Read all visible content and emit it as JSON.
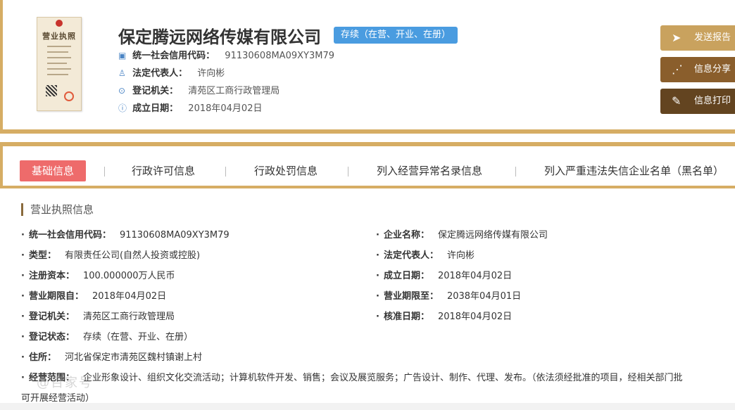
{
  "company": {
    "name": "保定腾远网络传媒有限公司",
    "status": "存续（在营、开业、在册）"
  },
  "license_image": {
    "title": "营业执照"
  },
  "summary": [
    {
      "icon": "id-card-icon",
      "label": "统一社会信用代码：",
      "value": "91130608MA09XY3M79"
    },
    {
      "icon": "person-icon",
      "label": "法定代表人：",
      "value": "许向彬"
    },
    {
      "icon": "location-pin-icon",
      "label": "登记机关：",
      "value": "清苑区工商行政管理局"
    },
    {
      "icon": "info-icon",
      "label": "成立日期：",
      "value": "2018年04月02日"
    }
  ],
  "actions": [
    {
      "label": "发送报告",
      "icon": "paper-plane-icon",
      "color": "#c9a25e"
    },
    {
      "label": "信息分享",
      "icon": "share-icon",
      "color": "#8a5e2c"
    },
    {
      "label": "信息打印",
      "icon": "pencil-icon",
      "color": "#634420"
    }
  ],
  "tabs": [
    {
      "label": "基础信息",
      "active": true
    },
    {
      "label": "行政许可信息"
    },
    {
      "label": "行政处罚信息"
    },
    {
      "label": "列入经营异常名录信息"
    },
    {
      "label": "列入严重违法失信企业名单（黑名单）"
    }
  ],
  "section": {
    "title": "营业执照信息"
  },
  "details_left": [
    {
      "label": "统一社会信用代码：",
      "value": "91130608MA09XY3M79"
    },
    {
      "label": "类型：",
      "value": "有限责任公司(自然人投资或控股)"
    },
    {
      "label": "注册资本：",
      "value": "100.000000万人民币"
    },
    {
      "label": "营业期限自：",
      "value": "2018年04月02日"
    },
    {
      "label": "登记机关：",
      "value": "清苑区工商行政管理局"
    },
    {
      "label": "登记状态：",
      "value": "存续（在营、开业、在册）"
    },
    {
      "label": "住所：",
      "value": "河北省保定市清苑区魏村镇谢上村"
    }
  ],
  "details_right": [
    {
      "label": "企业名称：",
      "value": "保定腾远网络传媒有限公司"
    },
    {
      "label": "法定代表人：",
      "value": "许向彬"
    },
    {
      "label": "成立日期：",
      "value": "2018年04月02日"
    },
    {
      "label": "营业期限至：",
      "value": "2038年04月01日"
    },
    {
      "label": "核准日期：",
      "value": "2018年04月02日"
    }
  ],
  "scope": {
    "label": "经营范围：",
    "line1": "企业形象设计、组织文化交流活动；计算机软件开发、销售；会议及展览服务；广告设计、制作、代理、发布。（依法须经批准的项目，经相关部门批",
    "line2": "可开展经营活动）"
  },
  "watermark": "@百家号"
}
